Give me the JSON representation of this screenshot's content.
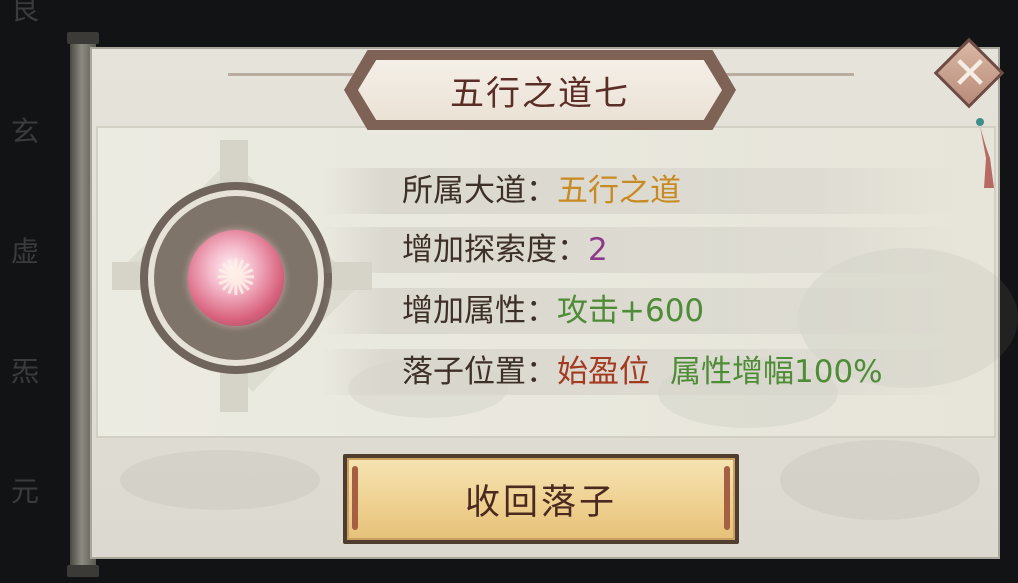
{
  "background_chars": [
    "艮",
    "玄",
    "虚",
    "炁",
    "元"
  ],
  "dialog": {
    "title": "五行之道七",
    "close_icon": "close-x-icon",
    "orb_icon": "pink-swirl-orb-icon"
  },
  "info": {
    "dao_label": "所属大道：",
    "dao_value": "五行之道",
    "explore_label": "增加探索度：",
    "explore_value": "2",
    "attr_label": "增加属性：",
    "attr_value": "攻击+600",
    "pos_label": "落子位置：",
    "pos_value": "始盈位",
    "pos_bonus": "属性增幅100%"
  },
  "buttons": {
    "recall_label": "收回落子"
  },
  "colors": {
    "gold": "#c88a22",
    "purple": "#8e3a8a",
    "green": "#4f8c37",
    "red": "#a33b22",
    "title": "#5a2e26"
  }
}
